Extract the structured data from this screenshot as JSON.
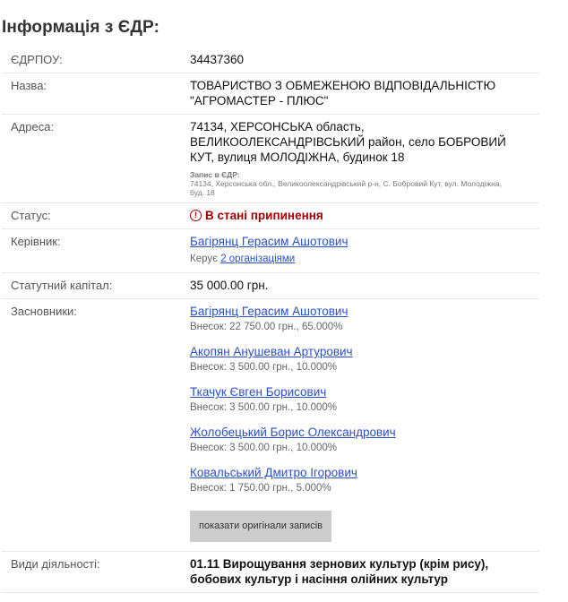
{
  "heading": "Інформація з ЄДР:",
  "edrpou": {
    "label": "ЄДРПОУ:",
    "value": "34437360"
  },
  "name": {
    "label": "Назва:",
    "line1": "ТОВАРИСТВО З ОБМЕЖЕНОЮ ВІДПОВІДАЛЬНІСТЮ",
    "line2": "\"АГРОМАСТЕР - ПЛЮС\""
  },
  "address": {
    "label": "Адреса:",
    "line1": "74134, ХЕРСОНСЬКА область,",
    "line2": "ВЕЛИКООЛЕКСАНДРІВСЬКИЙ район, село БОБРОВИЙ",
    "line3": "КУТ, вулиця МОЛОДІЖНА, будинок 18",
    "note_title": "Запис в ЄДР:",
    "note_line1": "74134, Херсонська обл., Великоолександрівський р-н, С. Бобровий Кут, вул. Молодіжна,",
    "note_line2": "буд. 18"
  },
  "status": {
    "label": "Статус:",
    "value": "В стані припинення",
    "icon": "!"
  },
  "director": {
    "label": "Керівник:",
    "name": "Багірянц Герасим Ашотович",
    "manages_prefix": "Керує",
    "manages_link": "2 організаціями"
  },
  "capital": {
    "label": "Статутний капітал:",
    "value": "35 000.00 грн."
  },
  "founders": {
    "label": "Засновники:",
    "items": [
      {
        "name": "Багірянц Герасим Ашотович",
        "share": "Внесок: 22 750.00 грн., 65.000%"
      },
      {
        "name": "Акопян Анушеван Артурович",
        "share": "Внесок: 3 500.00 грн., 10.000%"
      },
      {
        "name": "Ткачук Євген Борисович",
        "share": "Внесок: 3 500.00 грн., 10.000%"
      },
      {
        "name": "Жолобецький Борис Олександрович",
        "share": "Внесок: 3 500.00 грн., 10.000%"
      },
      {
        "name": "Ковальський Дмитро Ігорович",
        "share": "Внесок: 1 750.00 грн., 5.000%"
      }
    ],
    "button_label": "показати оригінали записів"
  },
  "activities": {
    "label": "Види діяльності:",
    "line1": "01.11 Вирощування зернових культур (крім рису),",
    "line2": "бобових культур і насіння олійних культур"
  },
  "colors": {
    "link": "#2a50c8",
    "status": "#a30000",
    "button_bg": "#cccccc"
  }
}
